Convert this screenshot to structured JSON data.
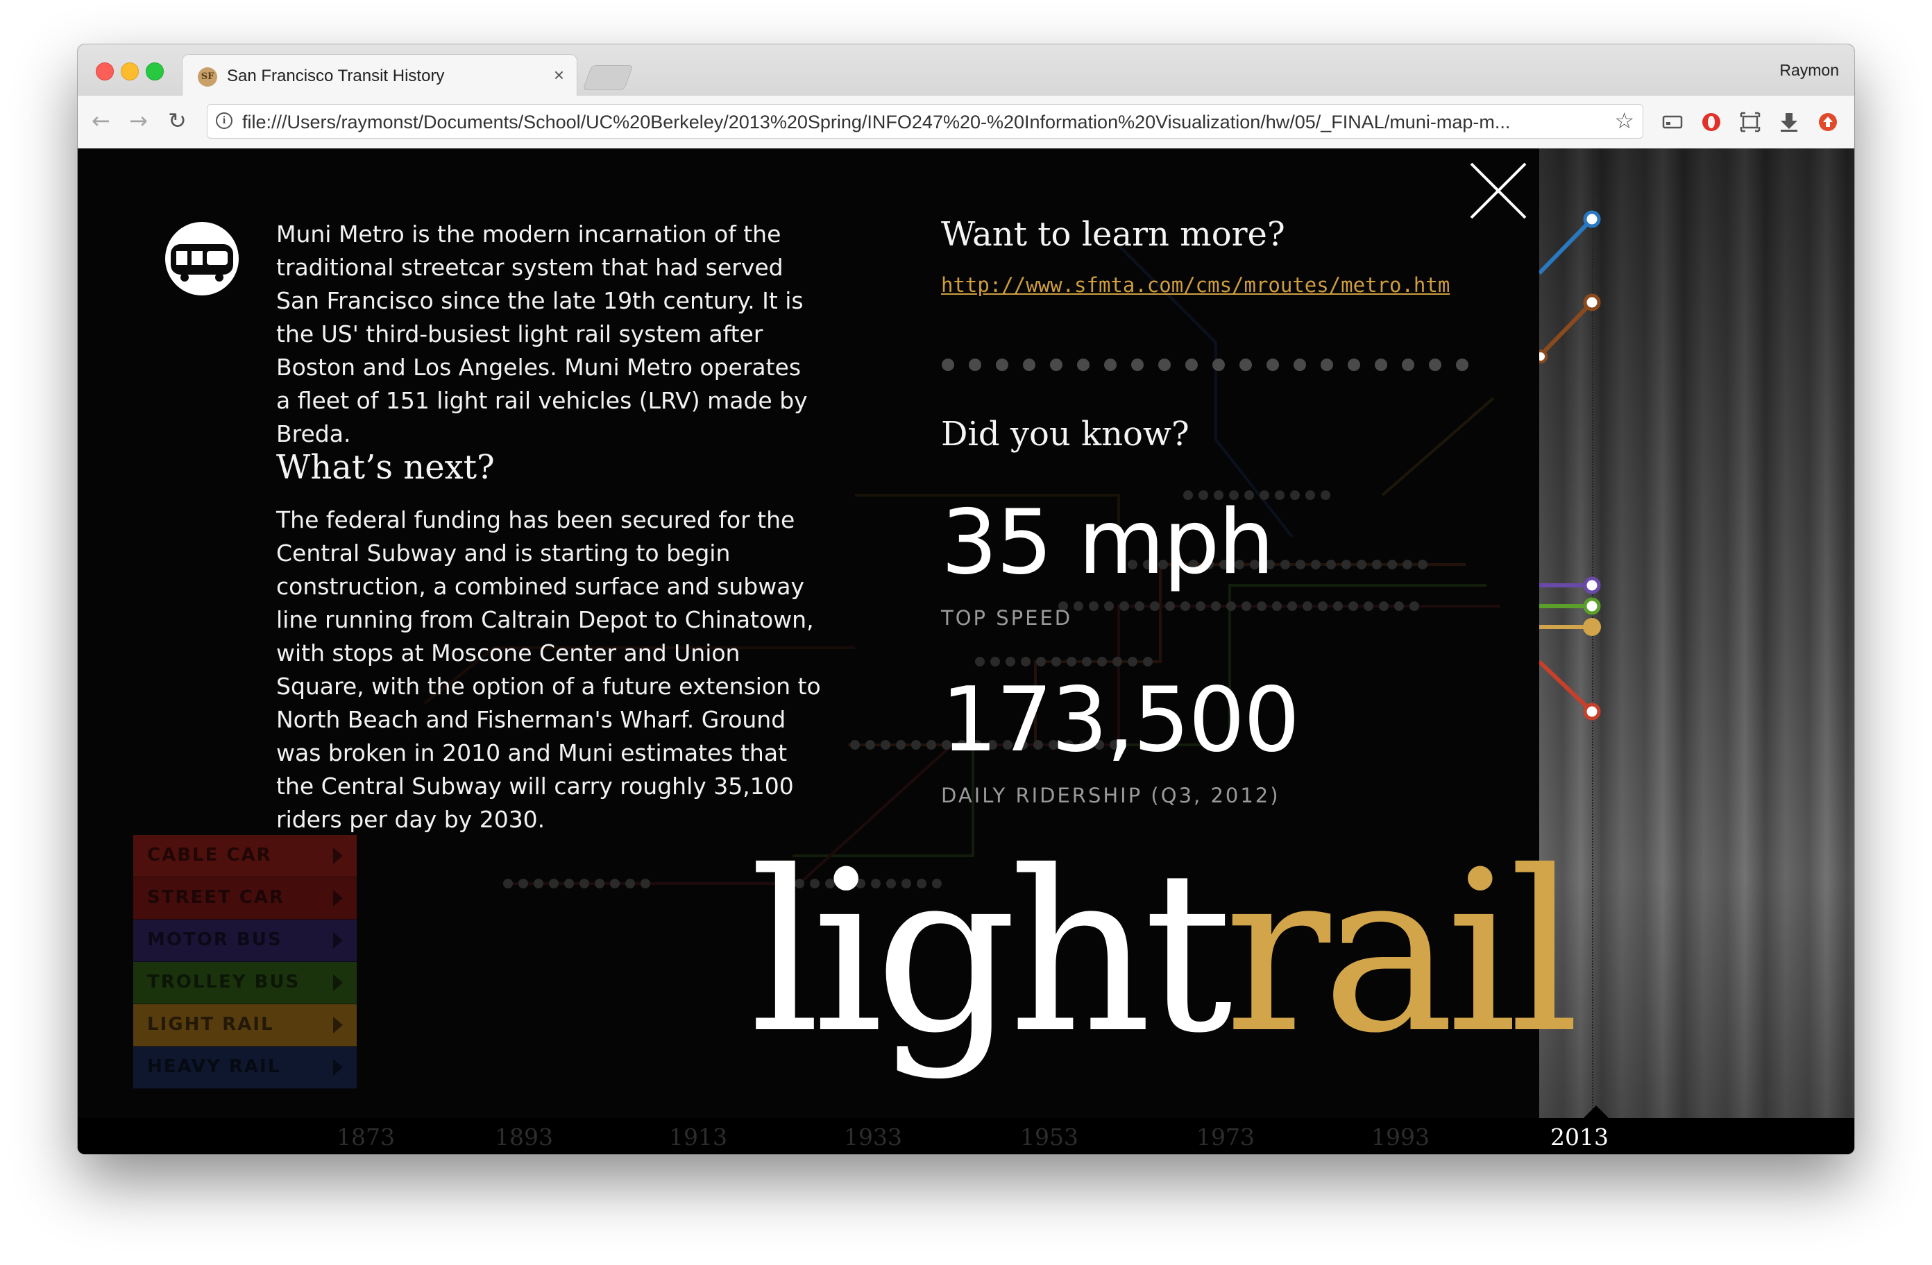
{
  "browser": {
    "tab_title": "San Francisco Transit History",
    "tab_favicon_text": "SF",
    "tab_close": "×",
    "profile_name": "Raymon",
    "url": "file:///Users/raymonst/Documents/School/UC%20Berkeley/2013%20Spring/INFO247%20-%20Information%20Visualization/hw/05/_FINAL/muni-map-m..."
  },
  "panel": {
    "intro": "Muni Metro is the modern incarnation of the traditional streetcar system that had served San Francisco since the late 19th century. It is the US' third-busiest light rail system after Boston and Los Angeles. Muni Metro operates a fleet of 151 light rail vehicles (LRV) made by Breda.",
    "next_heading": "What’s next?",
    "next_body": "The federal funding has been secured for the Central Subway and is starting to begin construction, a combined surface and subway line running from Caltrain Depot to Chinatown, with stops at Moscone Center and Union Square, with the option of a future extension to North Beach and Fisherman's Wharf. Ground was broken in 2010 and Muni estimates that the Central Subway will carry roughly 35,100 riders per day by 2030.",
    "learn_heading": "Want to learn more?",
    "learn_link": "http://www.sfmta.com/cms/mroutes/metro.htm",
    "know_heading": "Did you know?",
    "stat1_value": "35 mph",
    "stat1_label": "TOP SPEED",
    "stat2_value": "173,500",
    "stat2_label": "DAILY RIDERSHIP (Q3, 2012)",
    "title_part1": "light",
    "title_part2": "rail"
  },
  "legend": [
    {
      "label": "CABLE CAR",
      "color": "#8a1a14"
    },
    {
      "label": "STREET CAR",
      "color": "#7a1212"
    },
    {
      "label": "MOTOR BUS",
      "color": "#2e2160"
    },
    {
      "label": "TROLLEY BUS",
      "color": "#2e5a14"
    },
    {
      "label": "LIGHT RAIL",
      "color": "#9a6a16"
    },
    {
      "label": "HEAVY RAIL",
      "color": "#16264e"
    }
  ],
  "timeline": {
    "years": [
      "1873",
      "1893",
      "1913",
      "1933",
      "1953",
      "1973",
      "1993",
      "2013"
    ],
    "active_year": "2013"
  },
  "colors": {
    "accent": "#d2a54b",
    "link": "#cf9e3f",
    "line_blue": "#2a78c0",
    "line_brown": "#8a4a1e",
    "line_purple": "#6a4aa8",
    "line_green": "#5aa02a",
    "line_gold": "#d2a54b",
    "line_red": "#c8402a"
  }
}
